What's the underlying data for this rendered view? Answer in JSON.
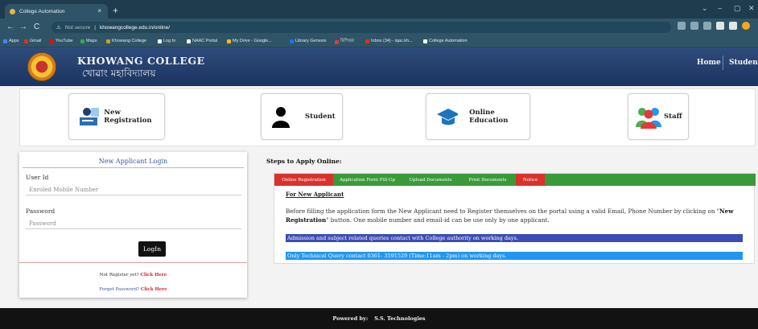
{
  "browser": {
    "tab_title": "College Automation",
    "tab_close": "×",
    "new_tab": "+",
    "window_controls": [
      "⌄",
      "–",
      "▢",
      "✕"
    ],
    "nav": {
      "back": "←",
      "forward": "→",
      "reload": "C"
    },
    "address": {
      "security_label": "Not secure",
      "url": "khowangcollege.edu.in/online/"
    },
    "bookmarks": [
      {
        "label": "Apps",
        "color": "#4285f4"
      },
      {
        "label": "Gmail",
        "color": "#d93025"
      },
      {
        "label": "YouTube",
        "color": "#ff0000"
      },
      {
        "label": "Maps",
        "color": "#34a853"
      },
      {
        "label": "Khowang College",
        "color": "#c9a227"
      },
      {
        "label": "Log In",
        "color": "#ffffff"
      },
      {
        "label": "NAAC Portal",
        "color": "#ffffff"
      },
      {
        "label": "My Drive - Google...",
        "color": "#fbbc04"
      },
      {
        "label": "Library Genesis",
        "color": "#1a73e8"
      },
      {
        "label": "রিপিতর",
        "color": "#e53935"
      },
      {
        "label": "Inbox (34) - iqac.kh...",
        "color": "#d93025"
      },
      {
        "label": "College Automation",
        "color": "#ffffff"
      }
    ]
  },
  "header": {
    "college_name_en": "KHOWANG COLLEGE",
    "college_name_local": "খোৱাং মহাবিদ্যালয়",
    "nav": [
      "Home",
      "Student"
    ]
  },
  "tiles": [
    {
      "label": "New Registration",
      "icon": "registration-icon"
    },
    {
      "label": "Student",
      "icon": "student-icon"
    },
    {
      "label": "Online Education",
      "icon": "graduation-cap-icon"
    },
    {
      "label": "Staff",
      "icon": "staff-icon"
    }
  ],
  "login": {
    "title": "New Applicant Login",
    "userid_label": "User Id",
    "userid_placeholder": "Enroled Mobile Number",
    "password_label": "Password",
    "password_placeholder": "Password",
    "button": "LogIn",
    "register_prompt": "Not Register yet?",
    "register_link": "Click Here",
    "forgot_prompt": "Forget Password?",
    "forgot_link": "Click Here"
  },
  "steps": {
    "title": "Steps to Apply Online:",
    "tabs": [
      "Online Registration",
      "Application Form Fill-Up",
      "Upload Documents",
      "Print Documents",
      "Notice"
    ],
    "active_tab": "Online Registration",
    "heading": "For New Applicant",
    "paragraph_lead": "Before filling the application form the New Applicant need to Register themselves on the portal using a valid Email, Phone Number by clicking on \"",
    "paragraph_bold": "New Registration",
    "paragraph_tail": "\" button. One mobile number and email-id can be use only by one applicant.",
    "notice_1": "Admission and subject related queries contact with College authority on working days.",
    "notice_2": "Only Technical Query contact 0361- 3591529 (Time:11am - 2pm) on working days.",
    "colors": {
      "tab_green": "#3a9a3a",
      "tab_red": "#d9322d",
      "notice_1": "#3b4db3",
      "notice_2": "#2196f3"
    }
  },
  "footer": {
    "prefix": "Powered by:",
    "company": "S.S. Technologies"
  }
}
